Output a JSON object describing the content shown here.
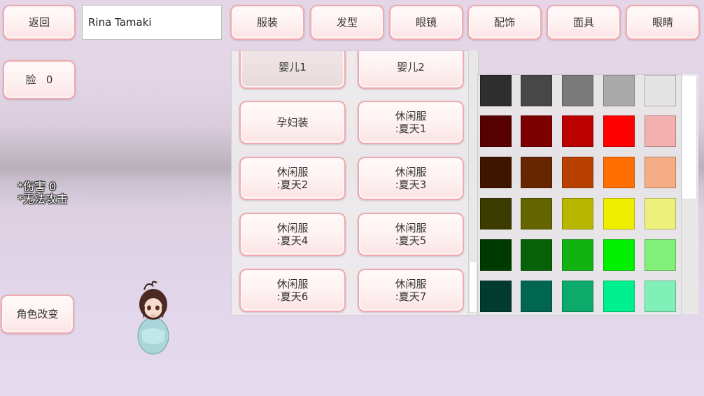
{
  "top_bar": {
    "back_label": "返回",
    "name_value": "Rina Tamaki",
    "tabs": [
      "服装",
      "发型",
      "眼镜",
      "配饰",
      "面具",
      "眼睛"
    ]
  },
  "side": {
    "face_label": "脸   0",
    "change_label": "角色改变"
  },
  "hud": {
    "line1": "*伤害 0",
    "line2": "*无法攻击"
  },
  "outfits": [
    "婴儿1",
    "婴儿2",
    "孕妇装",
    "休闲服\n:夏天1",
    "休闲服\n:夏天2",
    "休闲服\n:夏天3",
    "休闲服\n:夏天4",
    "休闲服\n:夏天5",
    "休闲服\n:夏天6",
    "休闲服\n:夏天7"
  ],
  "palette": [
    [
      "#2e2e2e",
      "#474747",
      "#7a7a7a",
      "#aaaaaa",
      "#e4e4e4"
    ],
    [
      "#560000",
      "#7d0000",
      "#bb0000",
      "#ff0000",
      "#f3b0b0"
    ],
    [
      "#401500",
      "#682600",
      "#b84100",
      "#ff7000",
      "#f5ad85"
    ],
    [
      "#3c3c00",
      "#646400",
      "#b7b700",
      "#eeee00",
      "#eef07c"
    ],
    [
      "#003a00",
      "#076207",
      "#12b212",
      "#00f000",
      "#80f07a"
    ],
    [
      "#003a30",
      "#006650",
      "#0daa6c",
      "#00f090",
      "#80f0b8"
    ]
  ]
}
